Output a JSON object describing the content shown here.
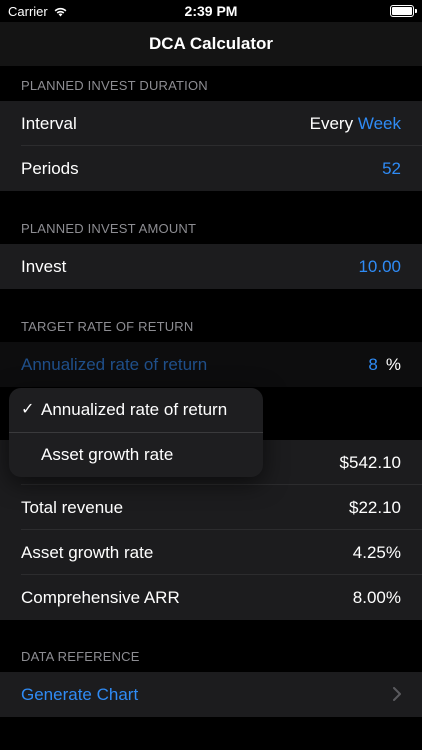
{
  "status_bar": {
    "carrier": "Carrier",
    "time": "2:39 PM"
  },
  "nav": {
    "title": "DCA Calculator"
  },
  "sections": {
    "duration": {
      "header": "PLANNED INVEST DURATION",
      "interval_label": "Interval",
      "interval_every": "Every",
      "interval_value": "Week",
      "periods_label": "Periods",
      "periods_value": "52"
    },
    "amount": {
      "header": "PLANNED INVEST AMOUNT",
      "invest_label": "Invest",
      "invest_value": "10.00"
    },
    "rate": {
      "header": "TARGET RATE OF RETURN",
      "mode_label": "Annualized rate of return",
      "rate_value": "8",
      "rate_unit": "%"
    },
    "results": {
      "total_value": "$542.10",
      "revenue_label": "Total revenue",
      "revenue_value": "$22.10",
      "growth_label": "Asset growth rate",
      "growth_value": "4.25%",
      "arr_label": "Comprehensive ARR",
      "arr_value": "8.00%"
    },
    "reference": {
      "header": "DATA REFERENCE",
      "chart_label": "Generate Chart"
    }
  },
  "popup_menu": {
    "items": [
      {
        "label": "Annualized rate of return",
        "checked": true,
        "check": "✓"
      },
      {
        "label": "Asset growth rate",
        "checked": false
      }
    ]
  },
  "colors": {
    "accent": "#2f8bf5",
    "cell": "#1c1c1e",
    "background": "#000000"
  }
}
